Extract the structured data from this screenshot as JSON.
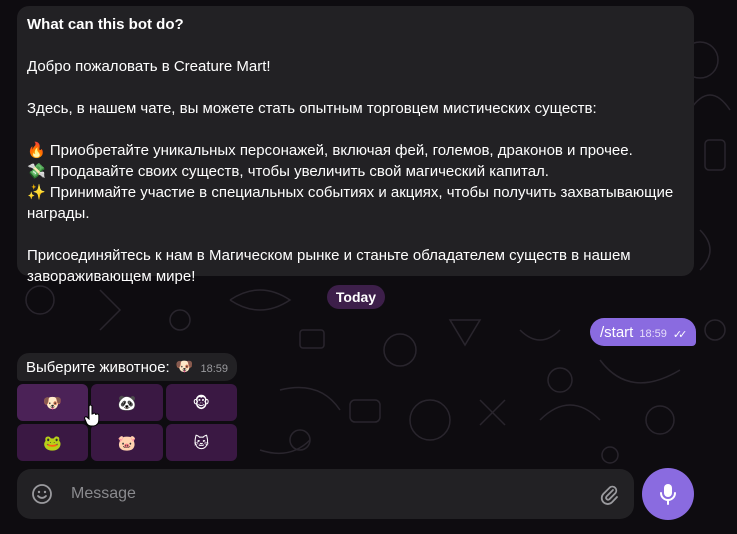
{
  "bot_info": {
    "title": "What can this bot do?",
    "welcome": "Добро пожаловать в Creature Mart!",
    "intro": "Здесь, в нашем чате, вы можете стать опытным торговцем мистических существ:",
    "features": [
      {
        "emoji": "🔥",
        "text": "Приобретайте уникальных персонажей, включая фей, големов, драконов и прочее."
      },
      {
        "emoji": "💸",
        "text": "Продавайте своих существ, чтобы увеличить свой магический капитал."
      },
      {
        "emoji": "✨",
        "text": "Принимайте участие в специальных событиях и акциях, чтобы получить захватывающие награды."
      }
    ],
    "outro": "Присоединяйтесь к нам в Магическом рынке и станьте обладателем существ в нашем завораживающем мире!"
  },
  "date_separator": "Today",
  "outgoing_message": {
    "text": "/start",
    "time": "18:59",
    "ticks": "✓✓"
  },
  "incoming_message": {
    "text": "Выберите животное:",
    "emoji": "🐶",
    "time": "18:59"
  },
  "keyboard": [
    {
      "emoji": "🐶",
      "name": "dog"
    },
    {
      "emoji": "🐼",
      "name": "panda"
    },
    {
      "emoji": "🐵",
      "name": "monkey"
    },
    {
      "emoji": "🐸",
      "name": "frog"
    },
    {
      "emoji": "🐷",
      "name": "pig"
    },
    {
      "emoji": "🐱",
      "name": "cat"
    }
  ],
  "composer": {
    "placeholder": "Message"
  },
  "colors": {
    "accent": "#8a6be0",
    "bubble": "#222124",
    "keyboard_button": "#3a1843",
    "date_chip": "#3d1f4a"
  },
  "icons": {
    "emoji": "smile-icon",
    "attach": "paperclip-icon",
    "send": "microphone-icon"
  }
}
